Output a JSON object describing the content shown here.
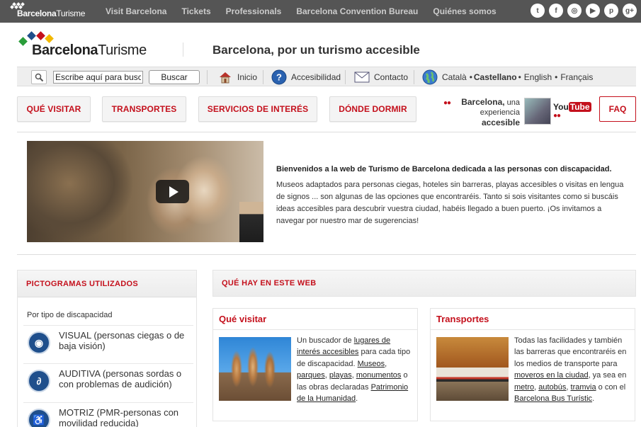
{
  "topbar": {
    "logo_bold": "Barcelona",
    "logo_light": "Turisme",
    "nav": [
      "Visit Barcelona",
      "Tickets",
      "Professionals",
      "Barcelona Convention Bureau",
      "Quiénes somos"
    ],
    "social": [
      {
        "name": "twitter-icon",
        "glyph": "t"
      },
      {
        "name": "facebook-icon",
        "glyph": "f"
      },
      {
        "name": "instagram-icon",
        "glyph": "◎"
      },
      {
        "name": "youtube-icon",
        "glyph": "▶"
      },
      {
        "name": "pinterest-icon",
        "glyph": "p"
      },
      {
        "name": "googleplus-icon",
        "glyph": "g+"
      }
    ]
  },
  "header": {
    "logo_bold": "Barcelona",
    "logo_light": "Turisme",
    "title": "Barcelona, por un turismo accesible"
  },
  "utilbar": {
    "search_value": "Escribe aquí para busca",
    "search_button": "Buscar",
    "inicio": "Inicio",
    "accesibilidad": "Accesibilidad",
    "contacto": "Contacto",
    "languages": [
      "Català",
      "Castellano",
      "English",
      "Français"
    ],
    "current_language": "Castellano",
    "separator": "•"
  },
  "mainnav": {
    "items": [
      "QUÉ VISITAR",
      "TRANSPORTES",
      "SERVICIOS DE INTERÉS",
      "DÓNDE DORMIR"
    ],
    "faq": "FAQ"
  },
  "promo": {
    "line1_bold": "Barcelona,",
    "line1_rest": " una",
    "line2": "experiencia",
    "line3": "accesible",
    "yt_you": "You",
    "yt_tube": "Tube"
  },
  "intro": {
    "title": "Bienvenidos a la web de Turismo de Barcelona dedicada a las personas con discapacidad.",
    "body": "Museos adaptados para personas ciegas, hoteles sin barreras, playas accesibles o visitas en lengua de signos ... son algunas de las opciones que encontraréis. Tanto si sois visitantes como si buscáis ideas accesibles para descubrir vuestra ciudad, habéis llegado a buen puerto. ¡Os invitamos a navegar por nuestro mar de sugerencias!"
  },
  "pictos": {
    "title": "PICTOGRAMAS UTILIZADOS",
    "subtitle": "Por tipo de discapacidad",
    "items": [
      {
        "label": "VISUAL (personas ciegas o de baja visión)",
        "glyph": "◉"
      },
      {
        "label": "AUDITIVA (personas sordas o con problemas de audición)",
        "glyph": "∂"
      },
      {
        "label": "MOTRIZ (PMR-personas con movilidad reducida)",
        "glyph": "♿"
      }
    ]
  },
  "quehay": {
    "title": "QUÉ HAY EN ESTE WEB",
    "cards": [
      {
        "title": "Qué visitar",
        "text": [
          {
            "t": "Un buscador de ",
            "u": false
          },
          {
            "t": "lugares de interés accesibles",
            "u": true
          },
          {
            "t": " para cada tipo de discapacidad. ",
            "u": false
          },
          {
            "t": "Museos",
            "u": true
          },
          {
            "t": ", ",
            "u": false
          },
          {
            "t": "parques",
            "u": true
          },
          {
            "t": ", ",
            "u": false
          },
          {
            "t": "playas",
            "u": true
          },
          {
            "t": ", ",
            "u": false
          },
          {
            "t": "monumentos",
            "u": true
          },
          {
            "t": " o las obras declaradas ",
            "u": false
          },
          {
            "t": "Patrimonio de la Humanidad",
            "u": true
          },
          {
            "t": ".",
            "u": false
          }
        ]
      },
      {
        "title": "Transportes",
        "text": [
          {
            "t": "Todas las facilidades y también las barreras que encontraréis en los medios de transporte para ",
            "u": false
          },
          {
            "t": "moveros en la ciudad",
            "u": true
          },
          {
            "t": ", ya sea en ",
            "u": false
          },
          {
            "t": "metro",
            "u": true
          },
          {
            "t": ", ",
            "u": false
          },
          {
            "t": "autobús",
            "u": true
          },
          {
            "t": ", ",
            "u": false
          },
          {
            "t": "tramvia",
            "u": true
          },
          {
            "t": " o con el ",
            "u": false
          },
          {
            "t": "Barcelona Bus Turístic",
            "u": true
          },
          {
            "t": ".",
            "u": false
          }
        ]
      }
    ]
  },
  "colors": {
    "accent_red": "#c4101c",
    "topbar_gray": "#555555",
    "picto_blue": "#1f4f8c"
  }
}
